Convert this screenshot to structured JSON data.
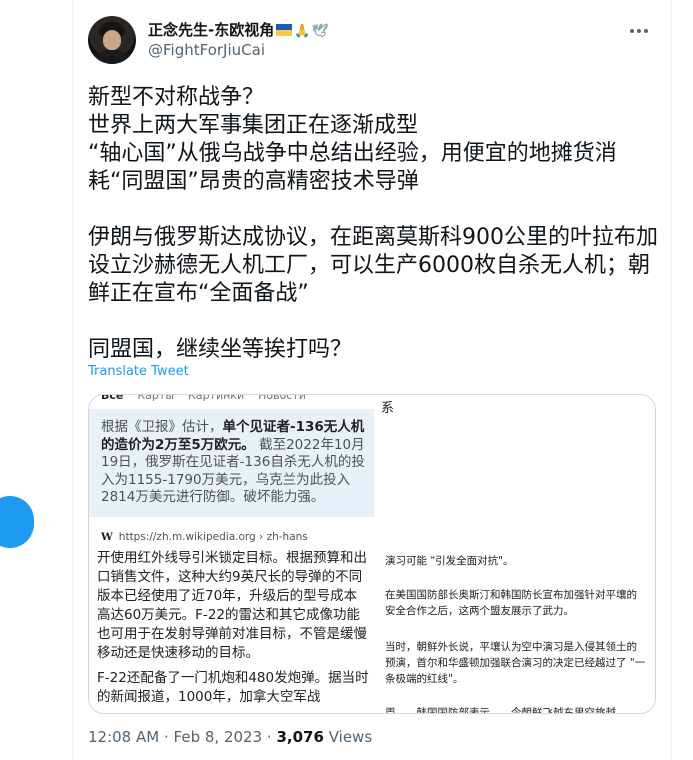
{
  "author": {
    "display_name": "正念先生-东欧视角",
    "flag_glyphs": "🇺🇦🙏🕊",
    "handle": "@FightForJiuCai"
  },
  "tweet": {
    "lines": [
      "新型不对称战争？",
      "世界上两大军事集团正在逐渐成型",
      "“轴心国”从俄乌战争中总结出经验，用便宜的地摊货消耗“同盟国”昂贵的高精密技术导弹",
      "",
      "伊朗与俄罗斯达成协议，在距离莫斯科900公里的叶拉布加设立沙赫德无人机工厂，可以生产6000枚自杀无人机；朝鲜正在宣布“全面备战”",
      "",
      "同盟国，继续坐等挨打吗？"
    ],
    "translate_label": "Translate Tweet",
    "time": "12:08 AM",
    "date": "Feb 8, 2023",
    "separator": "·",
    "views_count": "3,076",
    "views_label": "Views"
  },
  "media": {
    "search_tabs": [
      "Все",
      "Карты",
      "Картинки",
      "Новости"
    ],
    "snippet_lead": "根据《卫报》估计，",
    "snippet_bold": "单个见证者-136无人机的造价为2万至5万欧元。",
    "snippet_rest": "截至2022年10月19日，俄罗斯在见证者-136自杀无人机的投入为1155-1790万美元，乌克兰为此投入2814万美元进行防御。破坏能力强。",
    "wiki_logo": "W",
    "wiki_url": "https://zh.m.wikipedia.org › zh-hans",
    "article_p1": "开使用红外线导引米锁定目标。根据预算和出口销售文件，这种大约9英尺长的导弹的不同版本已经使用了近70年，升级后的型号成本高达60万美元。F-22的雷达和其它成像功能也可用于在发射导弹前对准目标，不管是缓慢移动还是快速移动的目标。",
    "article_p2": "F-22还配备了一门机炮和480发炮弹。据当时的新闻报道，1000年，加拿大空军战",
    "right_top": "系",
    "right_paras": [
      "演习可能 \"引发全面对抗\"。",
      "在美国国防部长奥斯汀和韩国防长宣布加强针对平壤的安全合作之后，这两个盟友展示了武力。",
      "当时，朝鲜外长说，平壤认为空中演习是入侵其领土的预演，首尔和华盛顿加强联合演习的决定已经越过了 \"一条极端的红线\"。",
      "周……韩国国防部表示……今朝鲜飞越东里空旅越"
    ]
  }
}
